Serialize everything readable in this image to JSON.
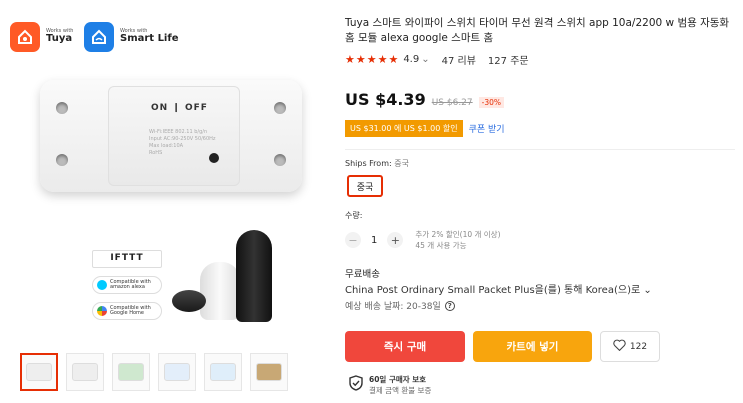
{
  "gallery": {
    "logos": [
      {
        "small": "Works with",
        "big": "Tuya"
      },
      {
        "small": "Works with",
        "big": "Smart Life"
      }
    ],
    "device": {
      "switch_label": "ON ❙ OFF",
      "spec_lines": [
        "Wi-Fi:IEEE 802.11 b/g/n",
        "Input AC:90-250V 50/60Hz",
        "Max load:10A",
        "RoHS"
      ]
    },
    "badges": [
      {
        "icon": "ifttt-icon",
        "text": "IFTTT"
      },
      {
        "icon": "alexa-icon",
        "line1": "Compatible with",
        "line2": "amazon alexa"
      },
      {
        "icon": "google-home-icon",
        "line1": "Compatible with",
        "line2": "Google Home"
      }
    ],
    "thumbnail_count": 6
  },
  "product": {
    "title": "Tuya 스마트 와이파이 스위치 타이머 무선 원격 스위치 app 10a/2200 w 범용 자동화 홈 모듈 alexa google 스마트 홈",
    "stars": "★★★★★",
    "rating": "4.9",
    "rating_chevron": "⌄",
    "reviews": "47 리뷰",
    "orders": "127 주문",
    "price": "US $4.39",
    "old_price": "US $6.27",
    "discount": "-30%",
    "coupon": "US $31.00 에 US $1.00 할인",
    "coupon_get": "쿠폰 받기"
  },
  "shipping_from": {
    "label": "Ships From:",
    "value": "중국",
    "option": "중국"
  },
  "quantity": {
    "label": "수량:",
    "minus": "−",
    "value": "1",
    "plus": "+",
    "note1": "추가 2% 할인(10 개 이상)",
    "note2": "45 개 사용 가능"
  },
  "shipping": {
    "title": "무료배송",
    "method": "China Post Ordinary Small Packet Plus을(를) 통해 Korea(으)로 ⌄",
    "delivery": "예상 배송 날짜: 20-38일",
    "help": "?"
  },
  "actions": {
    "buy_now": "즉시 구매",
    "add_to_cart": "카트에 넣기",
    "wishlist_count": "122"
  },
  "protection": {
    "title": "60일 구매자 보호",
    "subtitle": "결제 금액 환불 보증"
  },
  "colors": {
    "accent": "#e62e04",
    "buy": "#f0473c",
    "cart": "#f8a50d",
    "coupon": "#f29a00",
    "link": "#2b6de0"
  }
}
